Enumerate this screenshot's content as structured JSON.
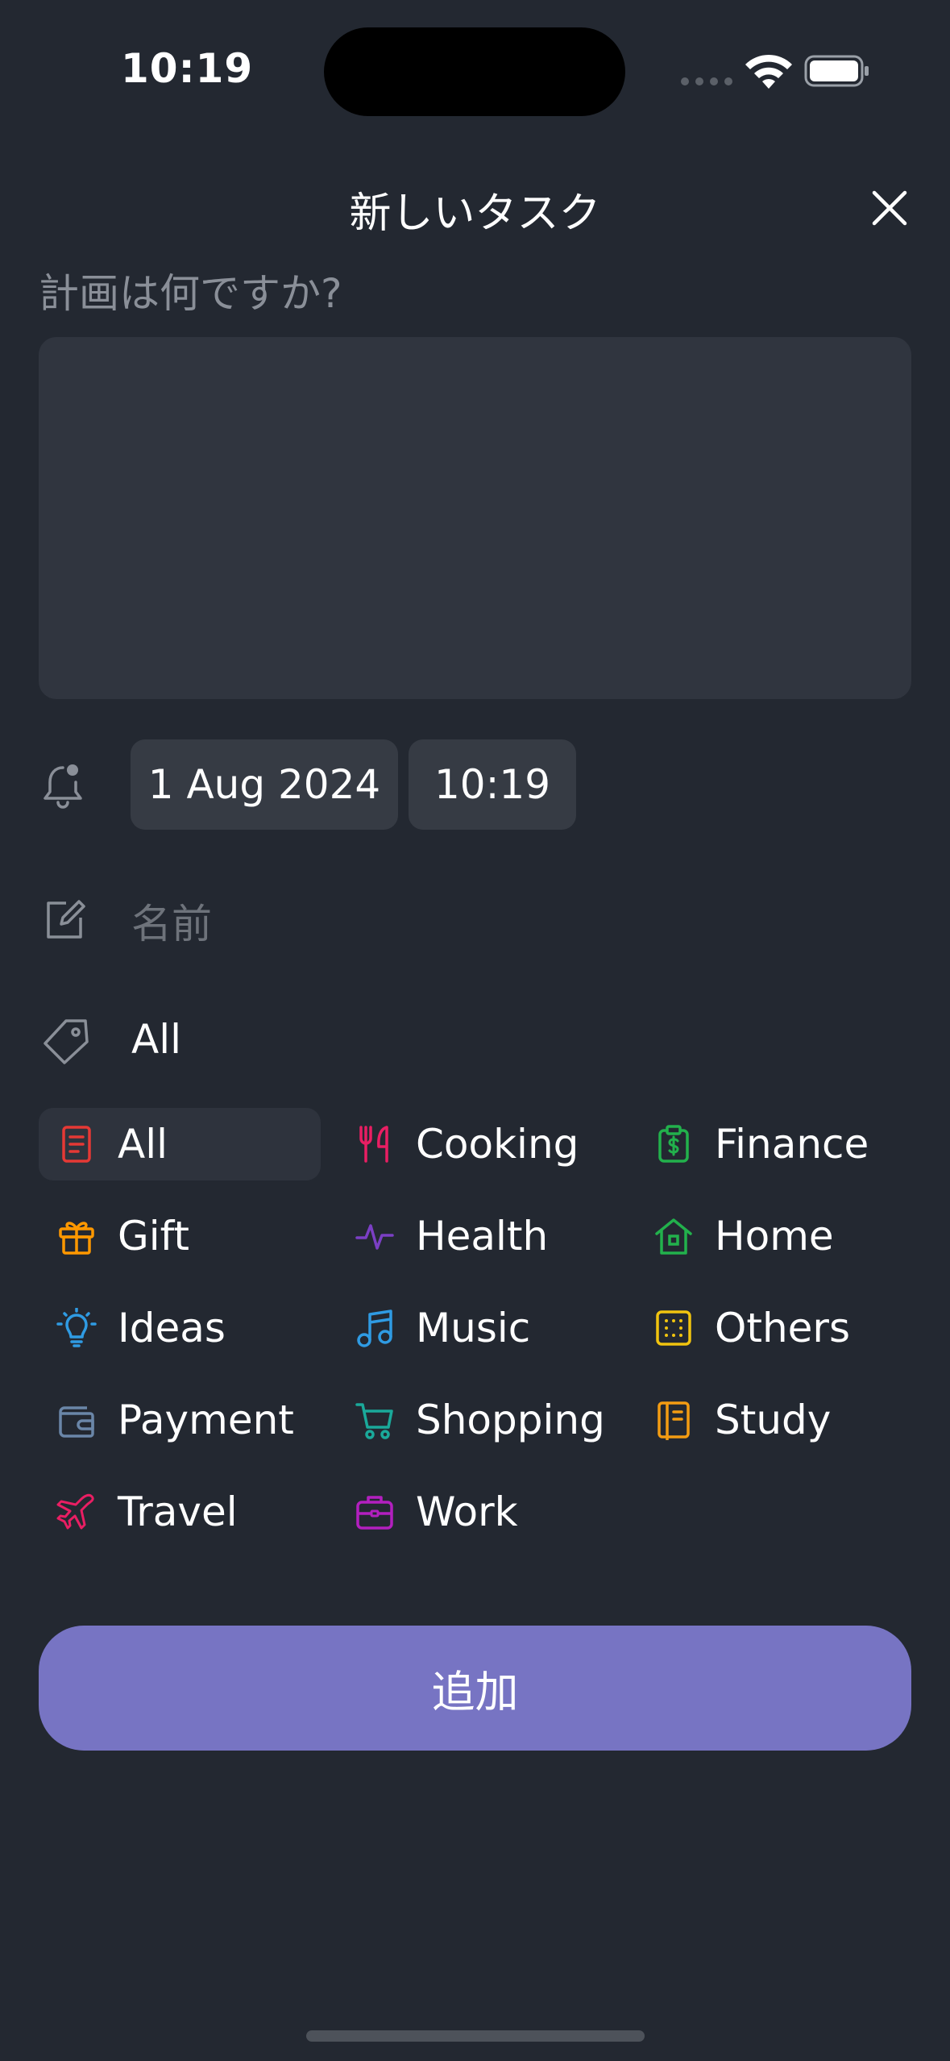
{
  "status": {
    "time": "10:19"
  },
  "header": {
    "title": "新しいタスク"
  },
  "form": {
    "question": "計画は何ですか?",
    "task_text": "",
    "date": "1 Aug 2024",
    "time": "10:19",
    "name_placeholder": "名前",
    "selected_category": "All"
  },
  "categories": [
    {
      "label": "All",
      "icon": "document-icon",
      "color": "#e53935",
      "selected": true
    },
    {
      "label": "Cooking",
      "icon": "utensils-icon",
      "color": "#e91e63"
    },
    {
      "label": "Finance",
      "icon": "clipboard-dollar-icon",
      "color": "#22b14c"
    },
    {
      "label": "Gift",
      "icon": "gift-icon",
      "color": "#ff9800"
    },
    {
      "label": "Health",
      "icon": "pulse-icon",
      "color": "#7b3fc4"
    },
    {
      "label": "Home",
      "icon": "house-icon",
      "color": "#22b14c"
    },
    {
      "label": "Ideas",
      "icon": "lightbulb-icon",
      "color": "#2f9be3"
    },
    {
      "label": "Music",
      "icon": "music-note-icon",
      "color": "#2f9be3"
    },
    {
      "label": "Others",
      "icon": "dotted-square-icon",
      "color": "#f1c40f"
    },
    {
      "label": "Payment",
      "icon": "wallet-icon",
      "color": "#6a86a8"
    },
    {
      "label": "Shopping",
      "icon": "cart-icon",
      "color": "#1aa99a"
    },
    {
      "label": "Study",
      "icon": "notebook-icon",
      "color": "#f39c12"
    },
    {
      "label": "Travel",
      "icon": "airplane-icon",
      "color": "#e91e63"
    },
    {
      "label": "Work",
      "icon": "briefcase-icon",
      "color": "#b31fbf"
    }
  ],
  "actions": {
    "add_label": "追加"
  }
}
